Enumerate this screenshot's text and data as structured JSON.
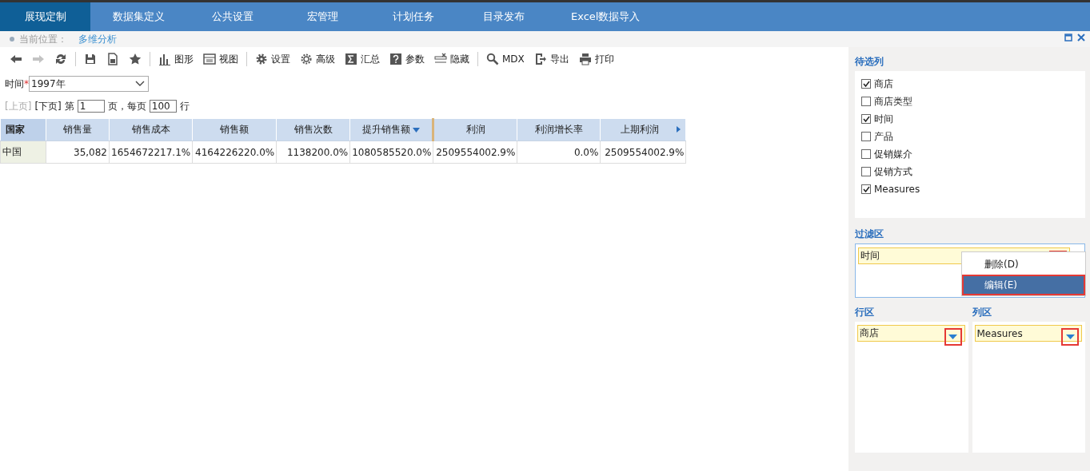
{
  "nav_tabs": [
    {
      "label": "展现定制",
      "selected": true
    },
    {
      "label": "数据集定义",
      "selected": false
    },
    {
      "label": "公共设置",
      "selected": false
    },
    {
      "label": "宏管理",
      "selected": false
    },
    {
      "label": "计划任务",
      "selected": false
    },
    {
      "label": "目录发布",
      "selected": false
    },
    {
      "label": "Excel数据导入",
      "selected": false
    }
  ],
  "breadcrumb": {
    "label": "当前位置：",
    "current": "多维分析"
  },
  "toolbar": [
    {
      "kind": "button",
      "disabled": false
    },
    {
      "kind": "button",
      "disabled": true
    },
    {
      "kind": "button",
      "disabled": false
    },
    {
      "kind": "separator"
    },
    {
      "kind": "button",
      "disabled": false
    },
    {
      "kind": "button",
      "disabled": false
    },
    {
      "kind": "button",
      "disabled": false
    },
    {
      "kind": "separator"
    },
    {
      "kind": "button",
      "label": "图形",
      "disabled": false
    },
    {
      "kind": "button",
      "label": "视图",
      "disabled": false
    },
    {
      "kind": "separator"
    },
    {
      "kind": "button",
      "label": "设置",
      "disabled": false
    },
    {
      "kind": "button",
      "label": "高级",
      "disabled": false
    },
    {
      "kind": "button",
      "label": "汇总",
      "disabled": false
    },
    {
      "kind": "button",
      "label": "参数",
      "disabled": false
    },
    {
      "kind": "button",
      "label": "隐藏",
      "disabled": false
    },
    {
      "kind": "separator"
    },
    {
      "kind": "button",
      "label": "MDX",
      "disabled": false
    },
    {
      "kind": "button",
      "label": "导出",
      "disabled": false
    },
    {
      "kind": "button",
      "label": "打印",
      "disabled": false
    }
  ],
  "time_filter": {
    "label": "时间",
    "required_mark": "*",
    "value": "1997年"
  },
  "pager": {
    "prev": {
      "label": "[上页]",
      "disabled": true
    },
    "next": {
      "label": "[下页]",
      "disabled": false
    },
    "page_prefix": "第",
    "page": "1",
    "page_suffix": "页，每页",
    "page_size": "100",
    "size_suffix": "行"
  },
  "table": {
    "columns": [
      {
        "label": "国家",
        "sorted": false
      },
      {
        "label": "销售量",
        "sorted": false
      },
      {
        "label": "销售成本",
        "sorted": false
      },
      {
        "label": "销售额",
        "sorted": false
      },
      {
        "label": "销售次数",
        "sorted": false
      },
      {
        "label": "提升销售额",
        "sorted": true
      },
      {
        "label": "利润",
        "sorted": false
      },
      {
        "label": "利润增长率",
        "sorted": false
      },
      {
        "label": "上期利润",
        "sorted": false
      }
    ],
    "rows": [
      [
        "中国",
        "35,082",
        "1654672217.1%",
        "4164226220.0%",
        "1138200.0%",
        "1080585520.0%",
        "2509554002.9%",
        "0.0%",
        "2509554002.9%"
      ]
    ]
  },
  "candidate_columns": {
    "title": "待选列",
    "items": [
      {
        "label": "商店",
        "checked": true
      },
      {
        "label": "商店类型",
        "checked": false
      },
      {
        "label": "时间",
        "checked": true
      },
      {
        "label": "产品",
        "checked": false
      },
      {
        "label": "促销媒介",
        "checked": false
      },
      {
        "label": "促销方式",
        "checked": false
      },
      {
        "label": "Measures",
        "checked": true
      }
    ]
  },
  "filter_zone": {
    "title": "过滤区",
    "items": [
      {
        "label": "时间",
        "highlighted": true
      }
    ]
  },
  "context_menu": [
    {
      "label": "删除(D)",
      "selected": false,
      "highlighted": false
    },
    {
      "label": "编辑(E)",
      "selected": true,
      "highlighted": true
    }
  ],
  "row_zone": {
    "title": "行区",
    "items": [
      {
        "label": "商店",
        "highlighted": true
      }
    ]
  },
  "column_zone": {
    "title": "列区",
    "items": [
      {
        "label": "Measures",
        "highlighted": true
      }
    ]
  }
}
